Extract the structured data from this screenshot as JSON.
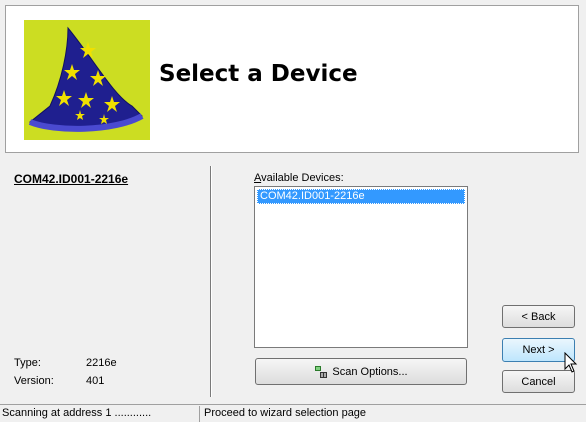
{
  "header": {
    "title": "Select a Device",
    "image_icon": "wizard-hat-icon"
  },
  "device_panel": {
    "device_name": "COM42.ID001-2216e",
    "type_label": "Type:",
    "type_value": "2216e",
    "version_label": "Version:",
    "version_value": "401"
  },
  "devices": {
    "label": "Available Devices:",
    "items": [
      "COM42.ID001-2216e"
    ],
    "selected_index": 0
  },
  "buttons": {
    "scan_options": "Scan Options...",
    "back": "< Back",
    "next": "Next >",
    "cancel": "Cancel"
  },
  "status": {
    "left": "Scanning at address 1 ............",
    "right": "Proceed to wizard selection page"
  },
  "colors": {
    "selection": "#3399ff",
    "hat": "#2a2a9a",
    "image_bg": "#ccdd22",
    "stars": "#f0e000"
  }
}
